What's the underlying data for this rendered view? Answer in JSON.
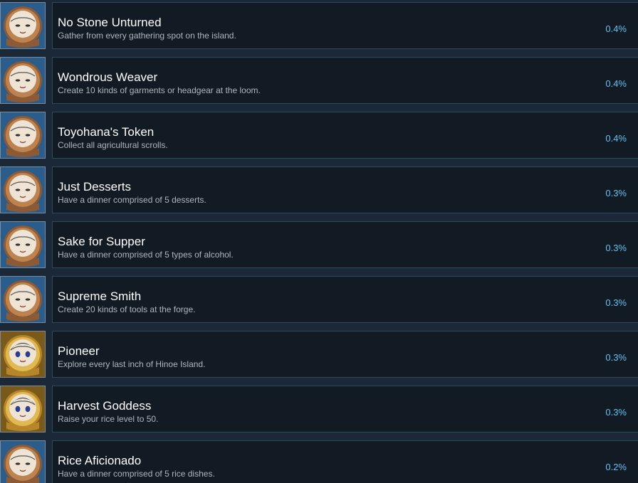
{
  "achievements": [
    {
      "title": "No Stone Unturned",
      "description": "Gather from every gathering spot on the island.",
      "percent": "0.4%",
      "icon": "badge-icon",
      "icon_variant": "blue",
      "icon_color": "#3d6fa0"
    },
    {
      "title": "Wondrous Weaver",
      "description": "Create 10 kinds of garments or headgear at the loom.",
      "percent": "0.4%",
      "icon": "badge-icon",
      "icon_variant": "blue",
      "icon_color": "#3d6fa0"
    },
    {
      "title": "Toyohana's Token",
      "description": "Collect all agricultural scrolls.",
      "percent": "0.4%",
      "icon": "badge-icon",
      "icon_variant": "blue",
      "icon_color": "#3d6fa0"
    },
    {
      "title": "Just Desserts",
      "description": "Have a dinner comprised of 5 desserts.",
      "percent": "0.3%",
      "icon": "badge-icon",
      "icon_variant": "blue",
      "icon_color": "#3d6fa0"
    },
    {
      "title": "Sake for Supper",
      "description": "Have a dinner comprised of 5 types of alcohol.",
      "percent": "0.3%",
      "icon": "badge-icon",
      "icon_variant": "blue",
      "icon_color": "#3d6fa0"
    },
    {
      "title": "Supreme Smith",
      "description": "Create 20 kinds of tools at the forge.",
      "percent": "0.3%",
      "icon": "badge-icon",
      "icon_variant": "blue",
      "icon_color": "#3d6fa0"
    },
    {
      "title": "Pioneer",
      "description": "Explore every last inch of Hinoe Island.",
      "percent": "0.3%",
      "icon": "badge-icon",
      "icon_variant": "gold",
      "icon_color": "#c99a2e"
    },
    {
      "title": "Harvest Goddess",
      "description": "Raise your rice level to 50.",
      "percent": "0.3%",
      "icon": "badge-icon",
      "icon_variant": "gold",
      "icon_color": "#c99a2e"
    },
    {
      "title": "Rice Aficionado",
      "description": "Have a dinner comprised of 5 rice dishes.",
      "percent": "0.2%",
      "icon": "badge-icon",
      "icon_variant": "blue",
      "icon_color": "#3d6fa0"
    }
  ]
}
